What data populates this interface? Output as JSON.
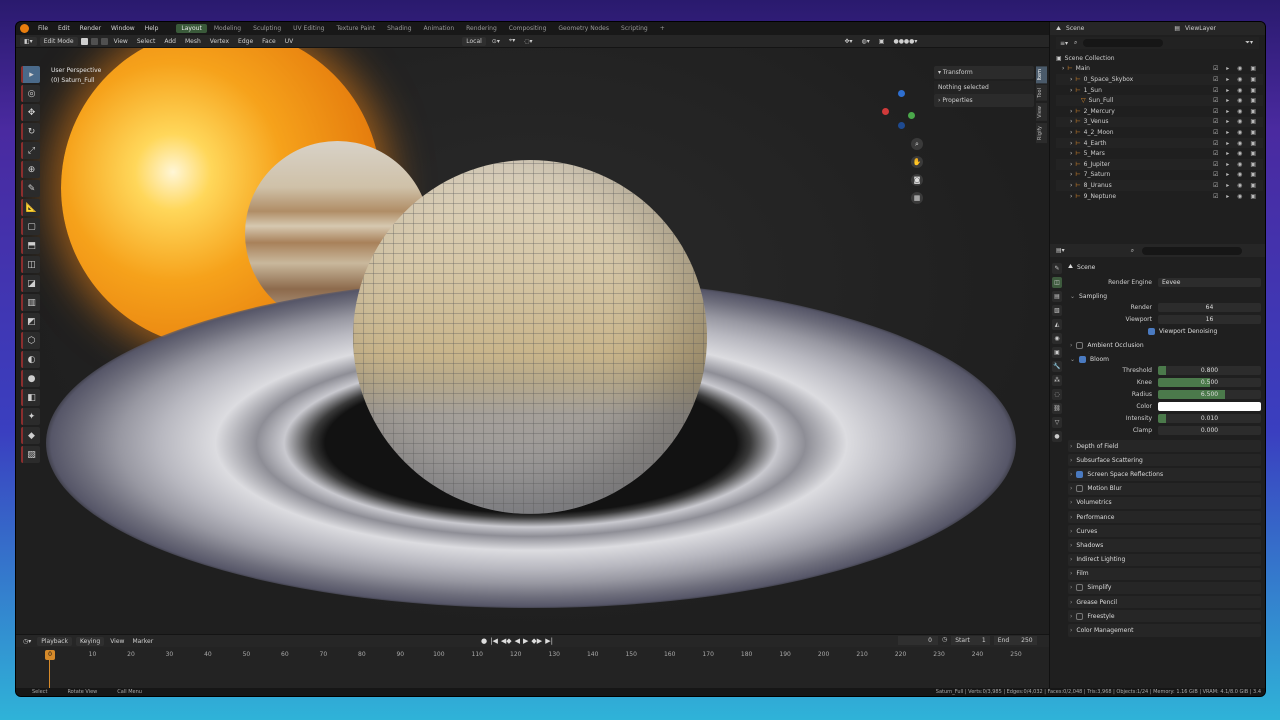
{
  "topbar": {
    "menus": [
      "File",
      "Edit",
      "Render",
      "Window",
      "Help"
    ],
    "workspaces": [
      "Layout",
      "Modeling",
      "Sculpting",
      "UV Editing",
      "Texture Paint",
      "Shading",
      "Animation",
      "Rendering",
      "Compositing",
      "Geometry Nodes",
      "Scripting"
    ],
    "active_workspace": "Layout",
    "add_tab": "+"
  },
  "viewport_header": {
    "mode": "Edit Mode",
    "menus": [
      "View",
      "Select",
      "Add",
      "Mesh",
      "Vertex",
      "Edge",
      "Face",
      "UV"
    ],
    "orientation": "Local",
    "xyz": [
      "X",
      "Y",
      "Z"
    ],
    "options": "Options"
  },
  "viewport": {
    "perspective": "User Perspective",
    "object": "(0) Saturn_Full"
  },
  "npanel": {
    "transform_title": "Transform",
    "nothing_selected": "Nothing selected",
    "properties_title": "Properties",
    "tabs": [
      "Item",
      "Tool",
      "View",
      "Rigify"
    ]
  },
  "timeline": {
    "menus": [
      "Playback",
      "Keying",
      "View",
      "Marker"
    ],
    "current_frame": "0",
    "start_label": "Start",
    "start": "1",
    "end_label": "End",
    "end": "250",
    "playhead": "0",
    "ruler": [
      "10",
      "20",
      "30",
      "40",
      "50",
      "60",
      "70",
      "80",
      "90",
      "100",
      "110",
      "120",
      "130",
      "140",
      "150",
      "160",
      "170",
      "180",
      "190",
      "200",
      "210",
      "220",
      "230",
      "240",
      "250"
    ]
  },
  "status": {
    "select": "Select",
    "rotate": "Rotate View",
    "call_menu": "Call Menu",
    "stats": "Saturn_Full | Verts:0/3,985 | Edges:0/4,032 | Faces:0/2,048 | Tris:3,968 | Objects:1/24 | Memory: 1.16 GiB | VRAM: 4.1/8.0 GiB | 3.4"
  },
  "outliner": {
    "scene": "Scene",
    "view_layer": "ViewLayer",
    "root": "Scene Collection",
    "items": [
      {
        "name": "Main",
        "indent": 0
      },
      {
        "name": "0_Space_Skybox",
        "indent": 1
      },
      {
        "name": "1_Sun",
        "indent": 1
      },
      {
        "name": "Sun_Full",
        "indent": 2
      },
      {
        "name": "2_Mercury",
        "indent": 1
      },
      {
        "name": "3_Venus",
        "indent": 1
      },
      {
        "name": "4_2_Moon",
        "indent": 1
      },
      {
        "name": "4_Earth",
        "indent": 1
      },
      {
        "name": "5_Mars",
        "indent": 1
      },
      {
        "name": "6_Jupiter",
        "indent": 1
      },
      {
        "name": "7_Saturn",
        "indent": 1
      },
      {
        "name": "8_Uranus",
        "indent": 1
      },
      {
        "name": "9_Neptune",
        "indent": 1
      }
    ]
  },
  "properties": {
    "scene": "Scene",
    "render_engine_label": "Render Engine",
    "render_engine": "Eevee",
    "sampling": "Sampling",
    "render_label": "Render",
    "render_val": "64",
    "viewport_label": "Viewport",
    "viewport_val": "16",
    "viewport_denoising": "Viewport Denoising",
    "ambient_occlusion": "Ambient Occlusion",
    "bloom": "Bloom",
    "threshold_label": "Threshold",
    "threshold": "0.800",
    "threshold_fill": 0.08,
    "knee_label": "Knee",
    "knee": "0.500",
    "knee_fill": 0.5,
    "radius_label": "Radius",
    "radius": "6.500",
    "radius_fill": 0.65,
    "color_label": "Color",
    "intensity_label": "Intensity",
    "intensity": "0.010",
    "intensity_fill": 0.08,
    "clamp_label": "Clamp",
    "clamp": "0.000",
    "panels": [
      "Depth of Field",
      "Subsurface Scattering",
      "Screen Space Reflections",
      "Motion Blur",
      "Volumetrics",
      "Performance",
      "Curves",
      "Shadows",
      "Indirect Lighting",
      "Film",
      "Simplify",
      "Grease Pencil",
      "Freestyle",
      "Color Management"
    ]
  },
  "colors": {
    "accent": "#3a5a3a",
    "playhead": "#d68a2a",
    "field_fill": "#4b7a4b"
  }
}
